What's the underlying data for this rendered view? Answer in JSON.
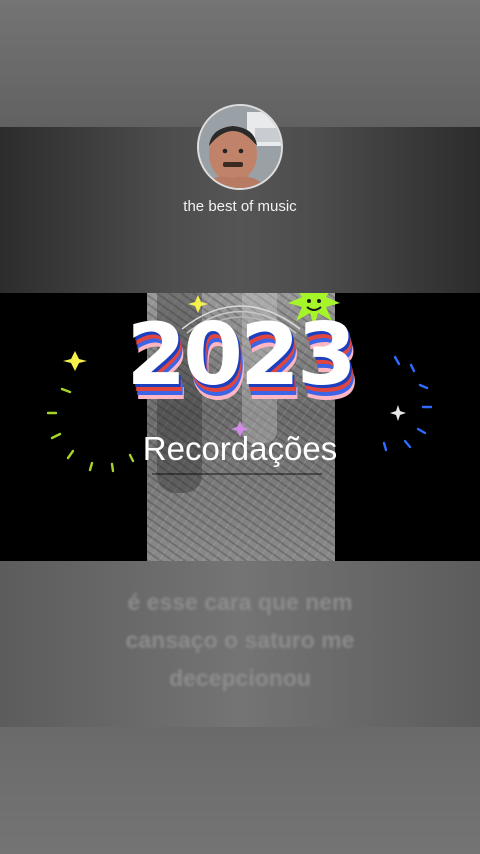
{
  "channel": {
    "name": "the best of music",
    "avatar": "profile-photo"
  },
  "video": {
    "year": "2023",
    "title": "Recordações",
    "colors": {
      "blue": "#1b3fbf",
      "red": "#e0463f",
      "star": "#a6f52a"
    }
  },
  "caption": {
    "lines": [
      "é esse cara que nem",
      "cansaço o saturo me",
      "decepcionou"
    ]
  }
}
